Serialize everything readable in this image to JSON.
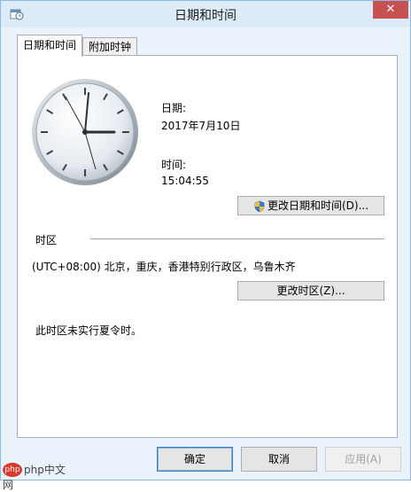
{
  "window": {
    "title": "日期和时间",
    "close_glyph": "✕"
  },
  "tabs": [
    {
      "label": "日期和时间",
      "active": true
    },
    {
      "label": "附加时钟",
      "active": false
    }
  ],
  "datetime": {
    "date_label": "日期:",
    "date_value": "2017年7月10日",
    "time_label": "时间:",
    "time_value": "15:04:55",
    "change_button": "更改日期和时间(D)..."
  },
  "timezone": {
    "section_label": "时区",
    "value": "(UTC+08:00) 北京，重庆，香港特别行政区，乌鲁木齐",
    "change_button": "更改时区(Z)...",
    "dst_note": "此时区未实行夏令时。"
  },
  "footer": {
    "ok": "确定",
    "cancel": "取消",
    "apply": "应用(A)"
  },
  "watermark": {
    "text": "php中文网"
  },
  "icons": {
    "app": "calendar-clock-icon",
    "uac": "uac-shield-icon"
  },
  "colors": {
    "accent_blue": "#3c7fb1",
    "close_red": "#c75050"
  }
}
